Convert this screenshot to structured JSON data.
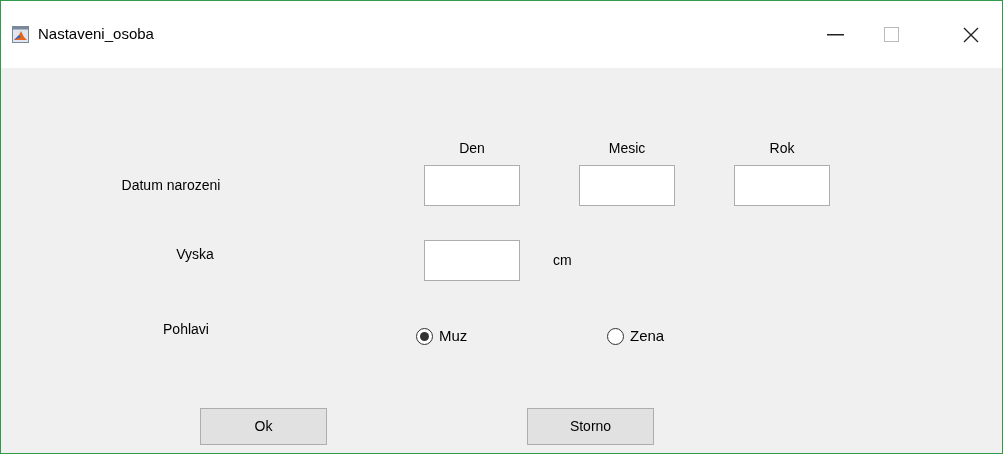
{
  "window": {
    "title": "Nastaveni_osoba"
  },
  "birth_date": {
    "label": "Datum narozeni",
    "fields": [
      {
        "label": "Den"
      },
      {
        "label": "Mesic"
      },
      {
        "label": "Rok"
      }
    ]
  },
  "height": {
    "label": "Vyska",
    "unit": "cm"
  },
  "gender": {
    "label": "Pohlavi",
    "options": [
      {
        "label": "Muz",
        "selected": true
      },
      {
        "label": "Zena",
        "selected": false
      }
    ]
  },
  "buttons": [
    "Ok",
    "Storno"
  ]
}
